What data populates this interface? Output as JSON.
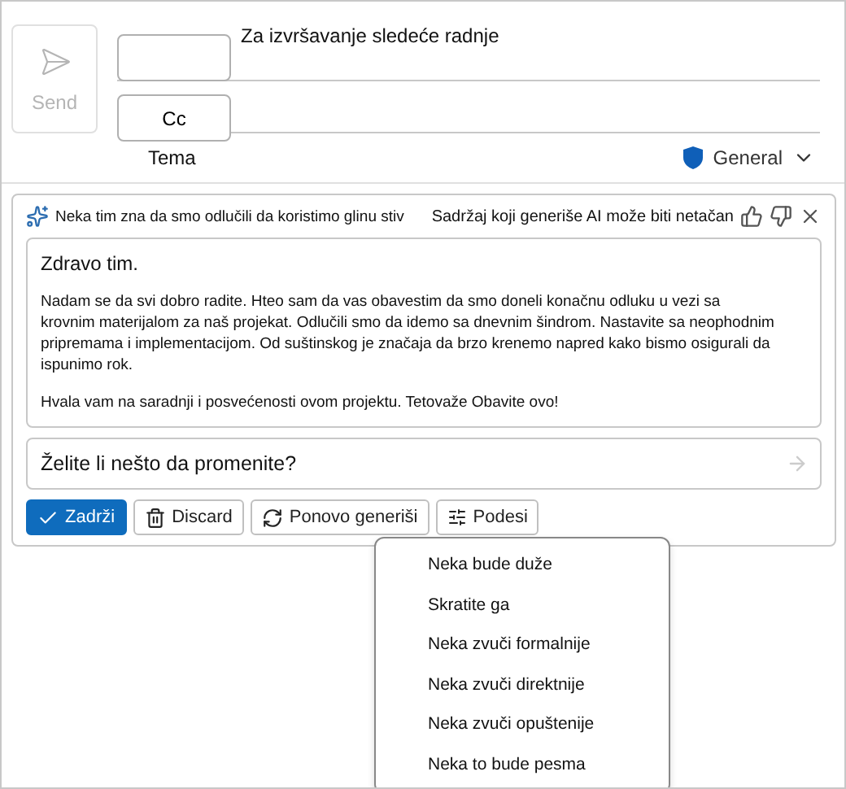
{
  "send_button": {
    "label": "Send",
    "disabled": true
  },
  "to_button": {
    "label": "Za izvršavanje sledeće radnje"
  },
  "cc_button": {
    "label": "Cc"
  },
  "subject": {
    "label": "Tema"
  },
  "sensitivity": {
    "label": "General"
  },
  "copilot": {
    "prompt": "Neka tim zna da smo odlučili da koristimo glinu stiv",
    "disclaimer": "Sadržaj koji generiše AI može biti netačan",
    "draft": [
      {
        "kind": "greeting",
        "text": "Zdravo tim."
      },
      {
        "kind": "paragraph",
        "text": "Nadam se da svi dobro radite. Hteo sam da vas obavestim da smo doneli konačnu odluku u vezi sa krovnim materijalom za naš projekat. Odlučili smo da idemo sa dnevnim šindrom. Nastavite sa neophodnim pripremama i implementacijom. Od suštinskog je značaja da brzo krenemo napred kako bismo osigurali da ispunimo rok."
      },
      {
        "kind": "paragraph",
        "text": "Hvala vam na saradnji i posvećenosti ovom projektu. Tetovaže Obavite ovo!"
      }
    ],
    "change_field": {
      "placeholder": "Želite li nešto da promenite?"
    },
    "actions": [
      {
        "kind": "keep",
        "label": "Zadrži"
      },
      {
        "kind": "discard",
        "label": "Discard"
      },
      {
        "kind": "regenerate",
        "label": "Ponovo generiši"
      },
      {
        "kind": "adjust",
        "label": "Podesi"
      }
    ]
  },
  "menu": {
    "items": [
      "Neka bude duže",
      "Skratite ga",
      "Neka zvuči formalnije",
      "Neka zvuči direktnije",
      "Neka zvuči opuštenije",
      "Neka to bude pesma"
    ]
  }
}
